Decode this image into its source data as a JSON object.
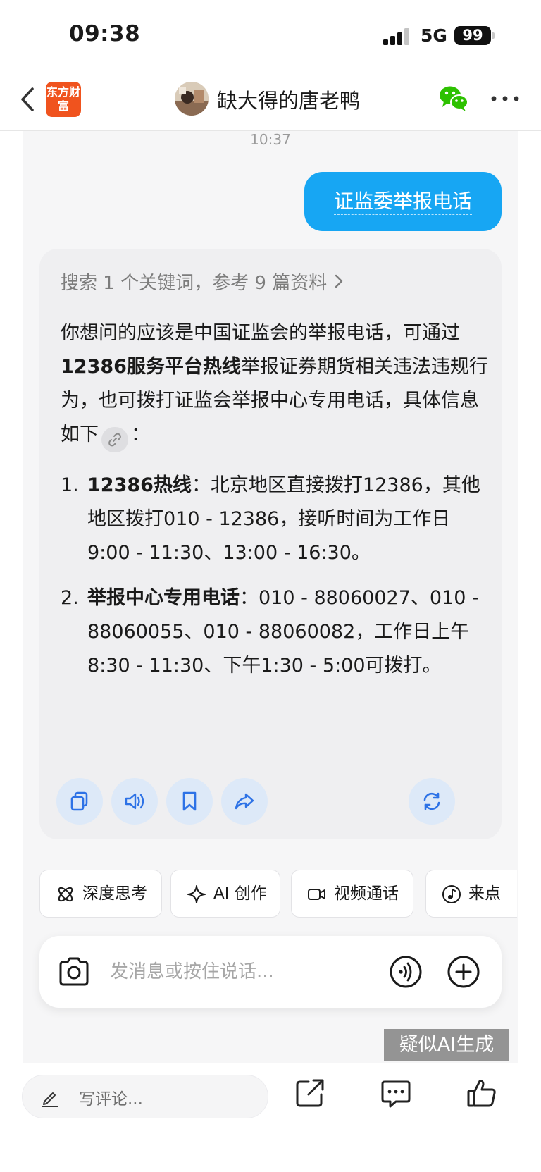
{
  "status_bar": {
    "time": "09:38",
    "network": "5G",
    "battery": "99"
  },
  "header": {
    "app_logo_text": "东方财富",
    "title": "缺大得的唐老鸭"
  },
  "chat": {
    "timestamp": "10:37",
    "user_message": "证监委举报电话",
    "ai_reply": {
      "search_summary": "搜索 1 个关键词，参考 9 篇资料",
      "intro_1": "你想问的应该是中国证监会的举报电话，可通过",
      "intro_bold": "12386服务平台热线",
      "intro_2": "举报证券期货相关违法违规行为，也可拨打证监会举报中心专用电话，具体信息如下",
      "intro_colon": "：",
      "items": [
        {
          "num": "1.",
          "title": "12386热线",
          "text": "：北京地区直接拨打12386，其他地区拨打010 - 12386，接听时间为工作日9:00 - 11:30、13:00 - 16:30。"
        },
        {
          "num": "2.",
          "title": "举报中心专用电话",
          "text": "：010 - 88060027、010 - 88060055、010 - 88060082，工作日上午8:30 - 11:30、下午1:30 - 5:00可拨打。"
        }
      ],
      "actions": [
        "copy-icon",
        "speaker-icon",
        "bookmark-icon",
        "share-icon",
        "regenerate-icon"
      ]
    }
  },
  "quick_actions": [
    {
      "label": "深度思考",
      "icon": "atom-icon"
    },
    {
      "label": "AI 创作",
      "icon": "sparkle-icon"
    },
    {
      "label": "视频通话",
      "icon": "video-icon"
    },
    {
      "label": "来点",
      "icon": "music-icon"
    }
  ],
  "input": {
    "placeholder": "发消息或按住说话..."
  },
  "watermark": "疑似AI生成",
  "bottom_bar": {
    "comment_placeholder": "写评论...",
    "icons": [
      "share-out-icon",
      "comments-icon",
      "like-icon"
    ]
  },
  "colors": {
    "accent_blue": "#17a6f3",
    "brand_orange": "#f0531e",
    "tool_button_bg": "#dde9f8",
    "tool_icon_blue": "#2d72e6"
  }
}
